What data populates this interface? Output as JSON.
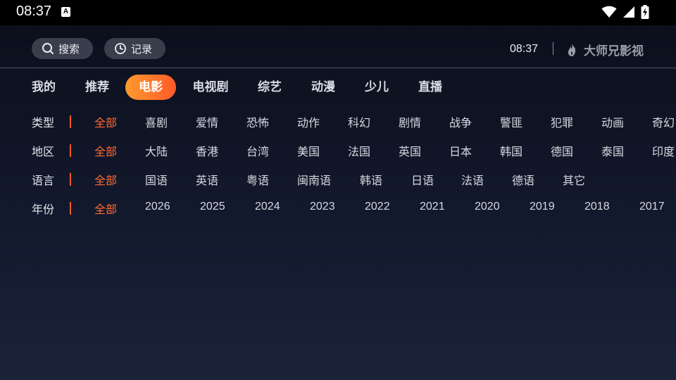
{
  "status_bar": {
    "time": "08:37",
    "notification_badge": "A",
    "icons": [
      "wifi-icon",
      "cell-signal-icon",
      "battery-charging-icon"
    ]
  },
  "header": {
    "search_label": "搜索",
    "history_label": "记录",
    "clock": "08:37",
    "brand_name": "大师兄影视"
  },
  "nav": {
    "tabs": [
      {
        "label": "我的"
      },
      {
        "label": "推荐"
      },
      {
        "label": "电影",
        "active": true
      },
      {
        "label": "电视剧"
      },
      {
        "label": "综艺"
      },
      {
        "label": "动漫"
      },
      {
        "label": "少儿"
      },
      {
        "label": "直播"
      }
    ]
  },
  "filters": {
    "type": {
      "label": "类型",
      "options": [
        "全部",
        "喜剧",
        "爱情",
        "恐怖",
        "动作",
        "科幻",
        "剧情",
        "战争",
        "警匪",
        "犯罪",
        "动画",
        "奇幻"
      ]
    },
    "region": {
      "label": "地区",
      "options": [
        "全部",
        "大陆",
        "香港",
        "台湾",
        "美国",
        "法国",
        "英国",
        "日本",
        "韩国",
        "德国",
        "泰国",
        "印度"
      ]
    },
    "language": {
      "label": "语言",
      "options": [
        "全部",
        "国语",
        "英语",
        "粤语",
        "闽南语",
        "韩语",
        "日语",
        "法语",
        "德语",
        "其它"
      ]
    },
    "year": {
      "label": "年份",
      "options": [
        "全部",
        "2026",
        "2025",
        "2024",
        "2023",
        "2022",
        "2021",
        "2020",
        "2019",
        "2018",
        "2017"
      ]
    }
  },
  "colors": {
    "accent": "#ff5a2a",
    "accent_gradient_start": "#ff9a2e",
    "selected_text": "#ff6a33"
  }
}
